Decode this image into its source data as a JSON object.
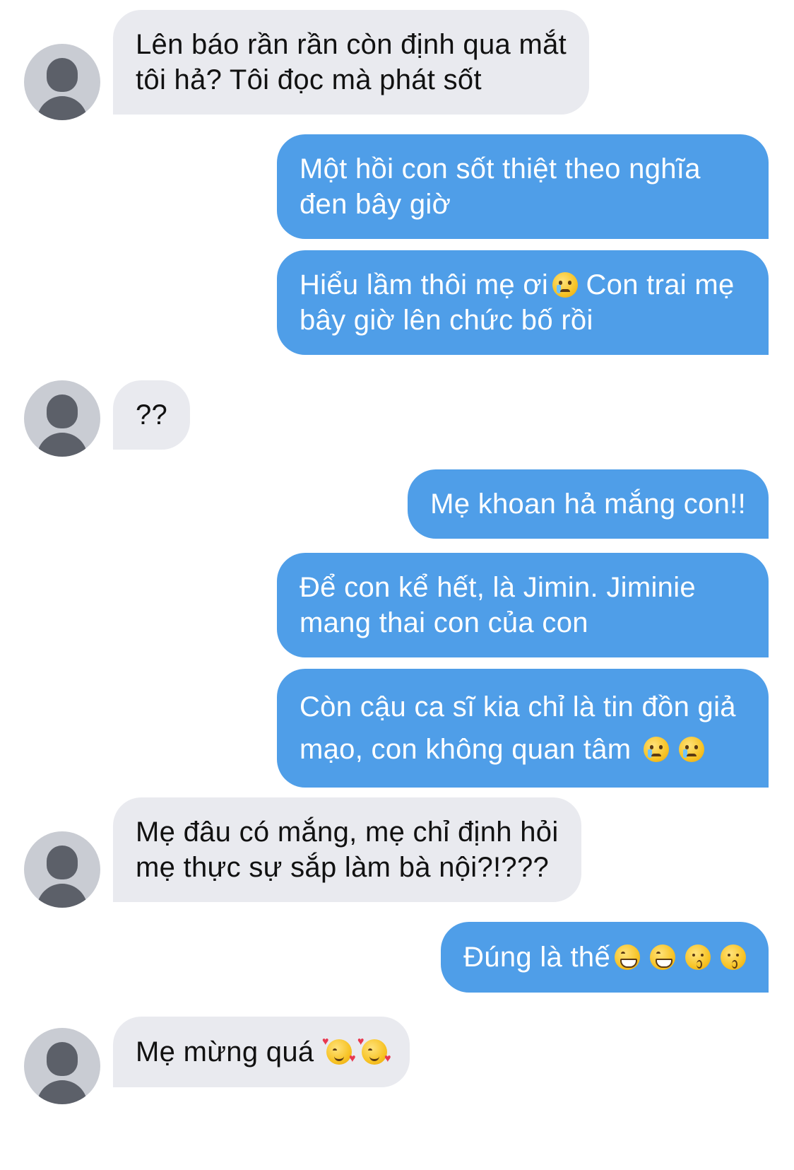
{
  "conversation": {
    "messages": [
      {
        "from": "mother",
        "lines": [
          "Lên báo rần rần còn định qua mắt",
          "tôi hả? Tôi đọc mà phát sốt"
        ]
      },
      {
        "from": "me",
        "lines": [
          "Một hồi con sốt thiệt theo nghĩa",
          "đen bây giờ"
        ]
      },
      {
        "from": "me",
        "lines": [
          "Hiểu lầm thôi mẹ ơi",
          " Con trai mẹ",
          "bây giờ lên chức bố rồi"
        ],
        "emojis": [
          "crying-face"
        ]
      },
      {
        "from": "mother",
        "lines": [
          "??"
        ]
      },
      {
        "from": "me",
        "lines": [
          "Mẹ khoan hả mắng con!!"
        ]
      },
      {
        "from": "me",
        "lines": [
          "Để con kể hết, là Jimin. Jiminie",
          "mang thai con của con"
        ]
      },
      {
        "from": "me",
        "lines": [
          "Còn cậu ca sĩ kia chỉ là tin đồn giả",
          "mạo, con không quan tâm "
        ],
        "emojis": [
          "crying-face",
          "crying-face"
        ]
      },
      {
        "from": "mother",
        "lines": [
          "Mẹ đâu có mắng, mẹ chỉ định hỏi",
          "mẹ thực sự sắp làm bà nội?!???"
        ]
      },
      {
        "from": "me",
        "lines": [
          "Đúng là thế"
        ],
        "emojis": [
          "grinning-face",
          "grinning-face",
          "kissing-face",
          "kissing-face"
        ]
      },
      {
        "from": "mother",
        "lines": [
          "Mẹ mừng quá "
        ],
        "emojis": [
          "smiling-face-with-hearts",
          "smiling-face-with-hearts"
        ]
      }
    ]
  }
}
